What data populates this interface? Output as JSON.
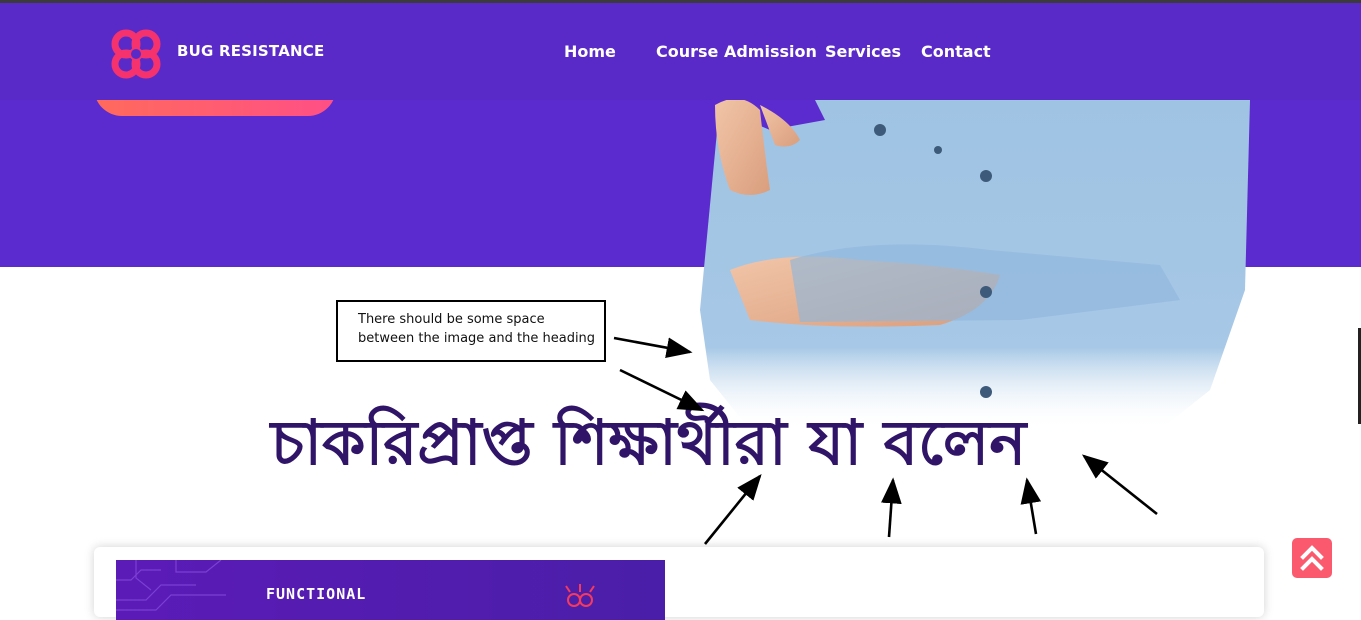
{
  "brand": {
    "name": "BUG RESISTANCE",
    "logo_icon": "pink-knot-logo-icon"
  },
  "nav": {
    "items": [
      {
        "label": "Home"
      },
      {
        "label": "Course Admission"
      },
      {
        "label": "Services"
      },
      {
        "label": "Contact"
      }
    ]
  },
  "annotation": {
    "text": "There should be some space between the image and the heading"
  },
  "section": {
    "heading": "চাকরিপ্রাপ্ত শিক্ষার্থীরা যা বলেন"
  },
  "card": {
    "image_text": "FUNCTIONAL"
  },
  "scroll_top": {
    "icon": "double-chevron-up-icon"
  },
  "colors": {
    "hero_bg": "#5b2bcf",
    "nav_bg": "#5a2ac8",
    "heading": "#2f1468",
    "accent": "#fb5a6e",
    "cta_gradient_start": "#ff6a5c",
    "cta_gradient_end": "#ff4f86"
  }
}
